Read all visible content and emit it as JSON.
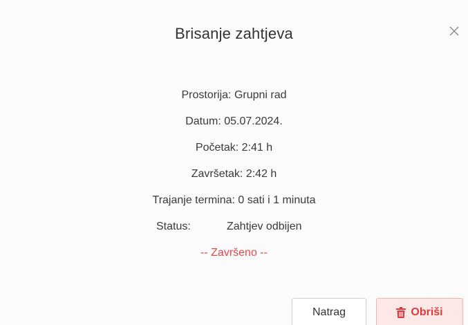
{
  "dialog": {
    "title": "Brisanje zahtjeva",
    "close_icon": "close-icon"
  },
  "details": {
    "room": "Prostorija: Grupni rad",
    "date": "Datum: 05.07.2024.",
    "start": "Početak: 2:41 h",
    "end": "Završetak: 2:42 h",
    "duration": "Trajanje termina: 0 sati i 1 minuta",
    "status_label": "Status:",
    "status_value": "Zahtjev odbijen",
    "finished": "-- Završeno --"
  },
  "footer": {
    "back_label": "Natrag",
    "delete_label": "Obriši",
    "delete_icon": "trash-icon"
  },
  "colors": {
    "danger": "#dc3b3b",
    "danger_bg": "#fde8e8",
    "finished_text": "#e5484d"
  }
}
